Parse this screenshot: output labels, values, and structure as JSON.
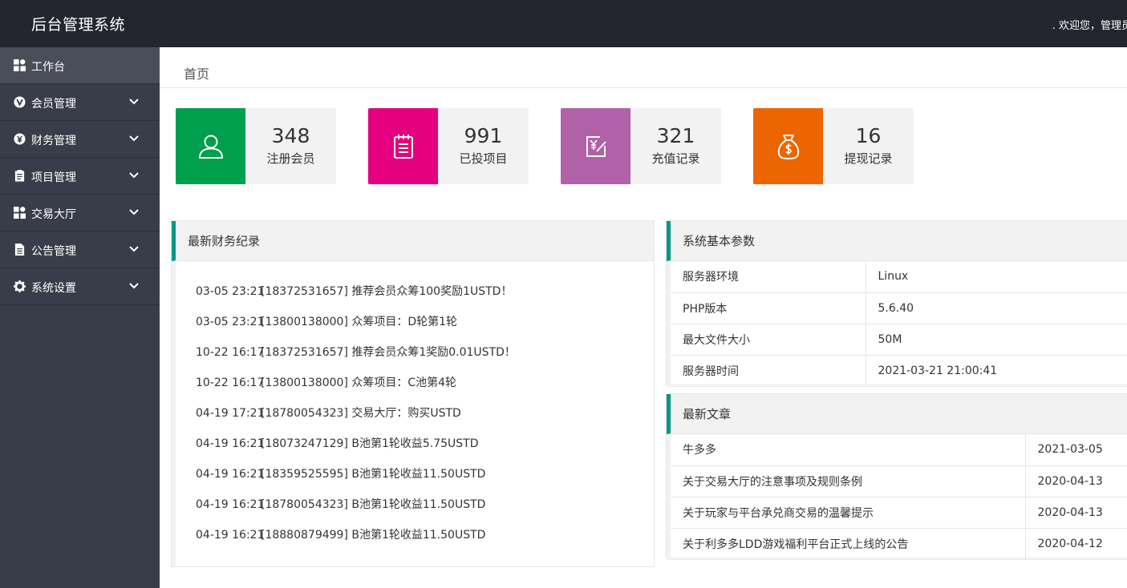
{
  "header": {
    "title": "后台管理系统",
    "welcome": ". 欢迎您，管理员"
  },
  "breadcrumb": "首页",
  "sidebar": {
    "items": [
      {
        "label": "工作台",
        "icon": "dashboard-icon"
      },
      {
        "label": "会员管理",
        "icon": "vip-icon"
      },
      {
        "label": "财务管理",
        "icon": "yen-icon"
      },
      {
        "label": "项目管理",
        "icon": "clipboard-icon"
      },
      {
        "label": "交易大厅",
        "icon": "dashboard-icon"
      },
      {
        "label": "公告管理",
        "icon": "file-icon"
      },
      {
        "label": "系统设置",
        "icon": "gear-icon"
      }
    ]
  },
  "stats": [
    {
      "value": "348",
      "label": "注册会员",
      "color": "#009f4d",
      "icon": "user-icon"
    },
    {
      "value": "991",
      "label": "已投项目",
      "color": "#e5007f",
      "icon": "notepad-icon"
    },
    {
      "value": "321",
      "label": "充值记录",
      "color": "#b061a8",
      "icon": "recharge-icon"
    },
    {
      "value": "16",
      "label": "提现记录",
      "color": "#ed6501",
      "icon": "money-bag-icon"
    }
  ],
  "finance": {
    "title": "最新财务纪录",
    "rows": [
      {
        "time": "03-05 23:21",
        "text": "[18372531657] 推荐会员众筹100奖励1USTD！"
      },
      {
        "time": "03-05 23:21",
        "text": "[13800138000] 众筹项目：D轮第1轮"
      },
      {
        "time": "10-22 16:17",
        "text": "[18372531657] 推荐会员众筹1奖励0.01USTD！"
      },
      {
        "time": "10-22 16:17",
        "text": "[13800138000] 众筹项目：C池第4轮"
      },
      {
        "time": "04-19 17:21",
        "text": "[18780054323] 交易大厅：购买USTD"
      },
      {
        "time": "04-19 16:21",
        "text": "[18073247129] B池第1轮收益5.75USTD"
      },
      {
        "time": "04-19 16:21",
        "text": "[18359525595] B池第1轮收益11.50USTD"
      },
      {
        "time": "04-19 16:21",
        "text": "[18780054323] B池第1轮收益11.50USTD"
      },
      {
        "time": "04-19 16:21",
        "text": "[18880879499] B池第1轮收益11.50USTD"
      }
    ]
  },
  "system": {
    "title": "系统基本参数",
    "rows": [
      {
        "key": "服务器环境",
        "value": "Linux"
      },
      {
        "key": "PHP版本",
        "value": "5.6.40"
      },
      {
        "key": "最大文件大小",
        "value": "50M"
      },
      {
        "key": "服务器时间",
        "value": "2021-03-21 21:00:41"
      }
    ]
  },
  "articles": {
    "title": "最新文章",
    "rows": [
      {
        "title": "牛多多",
        "date": "2021-03-05"
      },
      {
        "title": "关于交易大厅的注意事项及规则条例",
        "date": "2020-04-13"
      },
      {
        "title": "关于玩家与平台承兑商交易的温馨提示",
        "date": "2020-04-13"
      },
      {
        "title": "关于利多多LDD游戏福利平台正式上线的公告",
        "date": "2020-04-12"
      }
    ]
  },
  "colors": {
    "topbar": "#23262e",
    "sidebar": "#393d49",
    "accent": "#009688"
  }
}
